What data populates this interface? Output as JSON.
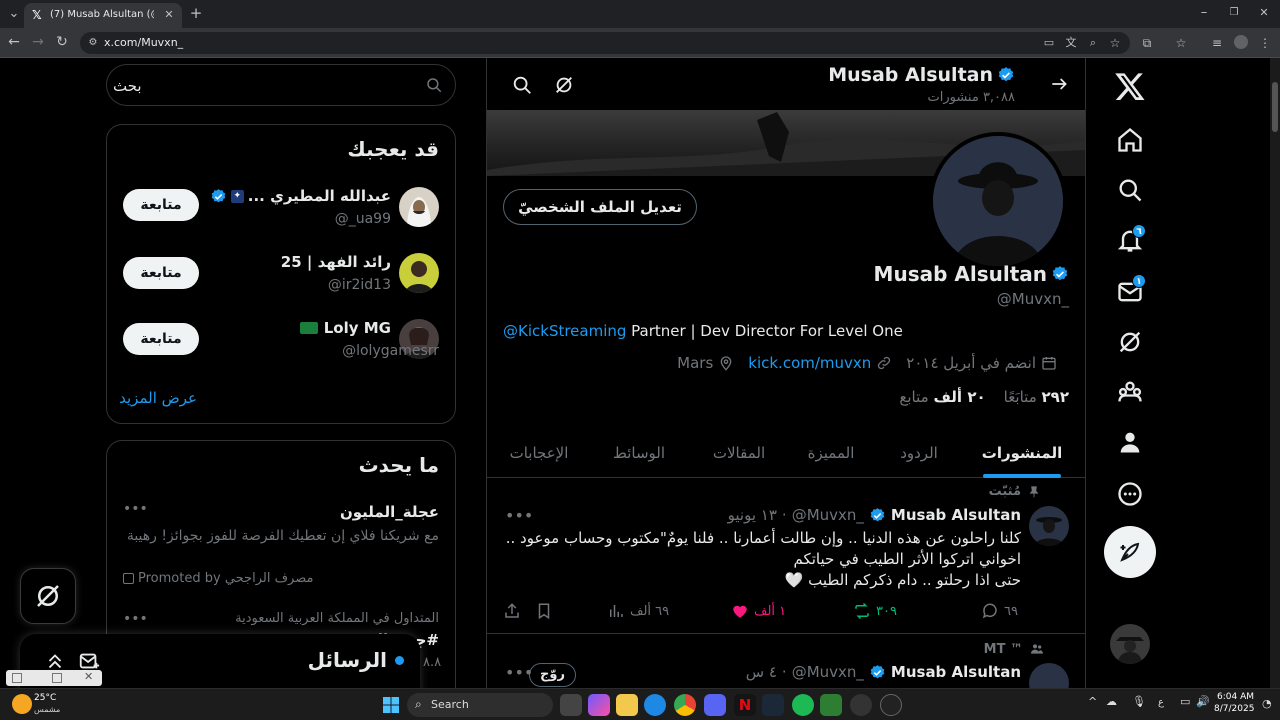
{
  "browser": {
    "tab_title": "(7) Musab Alsultan (@Muvxn_)",
    "url": "x.com/Muvxn_"
  },
  "colors": {
    "accent": "#1d9bf0",
    "like": "#f91880",
    "retweet": "#00ba7c",
    "bg": "#000000",
    "border": "#2f3336"
  },
  "search": {
    "placeholder": "بحث"
  },
  "suggestions": {
    "title": "قد يعجبك",
    "follow_label": "متابعة",
    "show_more": "عرض المزيد",
    "items": [
      {
        "name": "عبدالله المطيري ...",
        "handle": "@_ua99"
      },
      {
        "name": "رائد الفهد | 25",
        "handle": "@ir2id13"
      },
      {
        "name": "Loly MG",
        "handle": "@lolygamesrr"
      }
    ]
  },
  "trends": {
    "title": "ما يحدث",
    "items": [
      {
        "title": "عجلة_المليون",
        "desc": "مع شريكنا فلاي إن تعطيك الفرصة للفوز بجوائز! رهيبة",
        "promoted": "Promoted by مصرف الراجحي"
      },
      {
        "context": "المتداول في المملكة العربية السعودية",
        "title": "#جـ... الـ...",
        "count": "٨.٨"
      }
    ]
  },
  "messages": {
    "title": "الرسائل"
  },
  "profile": {
    "header_name": "Musab Alsultan",
    "header_posts": "٣,٠٨٨ منشورات",
    "name": "Musab Alsultan",
    "handle": "@Muvxn_",
    "edit_button": "تعديل الملف الشخصيّ",
    "bio_mention": "@KickStreaming",
    "bio_text": " Partner | Dev Director For Level One",
    "location": "Mars",
    "link": "kick.com/muvxn",
    "joined": "انضم في أبريل ٢٠١٤",
    "following_count": "٢٩٢",
    "following_label": "متابَعًا",
    "followers_count": "٢٠ ألف",
    "followers_label": "متابع"
  },
  "tabs": [
    "المنشورات",
    "الردود",
    "المميزة",
    "المقالات",
    "الوسائط",
    "الإعجابات"
  ],
  "posts": [
    {
      "pinned_label": "مُثبّت",
      "name": "Musab Alsultan",
      "handle": "@Muvxn_",
      "time": "١٣ يونيو",
      "lines": [
        "كلنا راحلون عن هذه الدنيا .. وإن طالت أعمارنا .. فلنا يومٌ\"مكتوب وحساب موعود ..",
        "اخواني اتركوا الأثر الطيب في حياتكم",
        "حتى اذا رحلتو .. دام ذكركم الطيب 🤍"
      ],
      "replies": "٦٩",
      "retweets": "٣٠٩",
      "likes": "١ ألف",
      "views": "٦٩ ألف"
    },
    {
      "community_label": "MT ™",
      "name": "Musab Alsultan",
      "handle": "@Muvxn_",
      "time": "٤ س",
      "chip": "روّج"
    }
  ],
  "nav_badges": {
    "notifications": "٦",
    "messages": "١"
  },
  "taskbar": {
    "weather_temp": "25°C",
    "weather_desc": "مشمس",
    "search": "Search",
    "lang": "ع",
    "time": "6:04 AM",
    "date": "8/7/2025"
  }
}
